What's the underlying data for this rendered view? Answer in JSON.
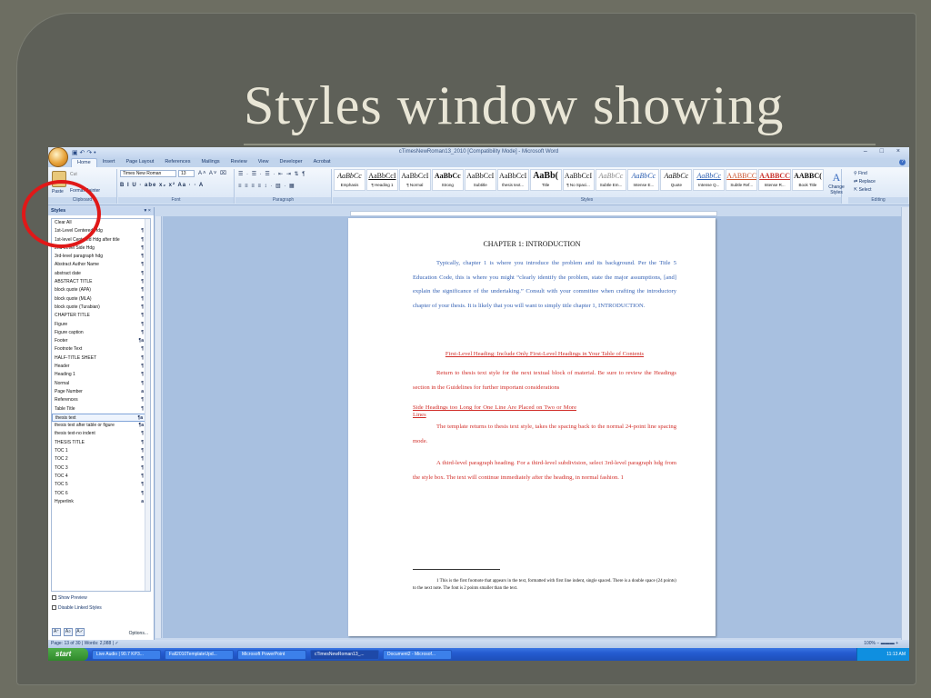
{
  "slide": {
    "title": "Styles window showing"
  },
  "window": {
    "title": "cTimesNewRoman13_2010 [Compatibility Mode] - Microsoft Word",
    "qat": "▣ ↶ ↷ •",
    "controls": "– □ ×"
  },
  "tabs": [
    "Home",
    "Insert",
    "Page Layout",
    "References",
    "Mailings",
    "Review",
    "View",
    "Developer",
    "Acrobat"
  ],
  "ribbon": {
    "clipboard": {
      "label": "Clipboard",
      "paste": "Paste",
      "cut": "Cut",
      "format_painter": "Format Painter"
    },
    "font": {
      "label": "Font",
      "name": "Times New Roman",
      "size": "13",
      "row1": "A˄ A˅ ⌧",
      "row2": "B I U · abe x₂ x² Aa · · A"
    },
    "paragraph": {
      "label": "Paragraph",
      "row1": "☰ · ☰ · ☰ · ⇤ ⇥ ⇅ ¶",
      "row2": "≡ ≡ ≡ ≡ ↕ · ▧ · ▦"
    },
    "styles_label": "Styles",
    "gallery": [
      {
        "sample": "AaBbCc",
        "name": "Emphasis"
      },
      {
        "sample": "AaBbCcI",
        "name": "¶ Heading 1"
      },
      {
        "sample": "AaBbCcI",
        "name": "¶ Normal"
      },
      {
        "sample": "AaBbCc",
        "name": "Strong"
      },
      {
        "sample": "AaBbCcI",
        "name": "Subtitle"
      },
      {
        "sample": "AaBbCcI",
        "name": "thesis text..."
      },
      {
        "sample": "AaBb(",
        "name": "Title"
      },
      {
        "sample": "AaBbCcI",
        "name": "¶ No Spaci..."
      },
      {
        "sample": "AaBbCc",
        "name": "Subtle Em..."
      },
      {
        "sample": "AaBbCc",
        "name": "Intense E..."
      },
      {
        "sample": "AaBbCc",
        "name": "Quote"
      },
      {
        "sample": "AaBbCc",
        "name": "Intense Q..."
      },
      {
        "sample": "AABBCC",
        "name": "Subtle Ref..."
      },
      {
        "sample": "AABBCC",
        "name": "Intense R..."
      },
      {
        "sample": "AABBC(",
        "name": "Book Title"
      }
    ],
    "change_styles": "Change Styles",
    "editing": {
      "label": "Editing",
      "find": "Find",
      "replace": "Replace",
      "select": "Select"
    }
  },
  "styles_pane": {
    "title": "Styles",
    "close": "▾ ×",
    "items": [
      {
        "name": "Clear All",
        "mark": ""
      },
      {
        "name": "1st-Level Centered Hdg",
        "mark": "¶"
      },
      {
        "name": "1st-level Centered Hdg after title",
        "mark": "¶"
      },
      {
        "name": "2nd-Level Side Hdg",
        "mark": "¶"
      },
      {
        "name": "3rd-level paragraph hdg",
        "mark": "¶"
      },
      {
        "name": "Abstract Author Name",
        "mark": "¶"
      },
      {
        "name": "abstract date",
        "mark": "¶"
      },
      {
        "name": "ABSTRACT TITLE",
        "mark": "¶"
      },
      {
        "name": "block quote (APA)",
        "mark": "¶"
      },
      {
        "name": "block quote (MLA)",
        "mark": "¶"
      },
      {
        "name": "block quote (Turabian)",
        "mark": "¶"
      },
      {
        "name": "CHAPTER TITLE",
        "mark": "¶"
      },
      {
        "name": "Figure",
        "mark": "¶"
      },
      {
        "name": "Figure caption",
        "mark": "¶"
      },
      {
        "name": "Footer",
        "mark": "¶a"
      },
      {
        "name": "Footnote Text",
        "mark": "¶"
      },
      {
        "name": "HALF-TITLE SHEET",
        "mark": "¶"
      },
      {
        "name": "Header",
        "mark": "¶"
      },
      {
        "name": "Heading 1",
        "mark": "¶"
      },
      {
        "name": "Normal",
        "mark": "¶"
      },
      {
        "name": "Page Number",
        "mark": "a"
      },
      {
        "name": "References",
        "mark": "¶"
      },
      {
        "name": "Table Title",
        "mark": "¶"
      },
      {
        "name": "thesis text",
        "mark": "¶a"
      },
      {
        "name": "thesis text after table or figure",
        "mark": "¶a"
      },
      {
        "name": "thesis text-no indent",
        "mark": "¶"
      },
      {
        "name": "THESIS TITLE",
        "mark": "¶"
      },
      {
        "name": "TOC 1",
        "mark": "¶"
      },
      {
        "name": "TOC 2",
        "mark": "¶"
      },
      {
        "name": "TOC 3",
        "mark": "¶"
      },
      {
        "name": "TOC 4",
        "mark": "¶"
      },
      {
        "name": "TOC 5",
        "mark": "¶"
      },
      {
        "name": "TOC 6",
        "mark": "¶"
      },
      {
        "name": "Hyperlink",
        "mark": "a"
      }
    ],
    "selected": "thesis text",
    "show_preview": "Show Preview",
    "disable_linked": "Disable Linked Styles",
    "options": "Options..."
  },
  "document": {
    "heading": "CHAPTER 1: INTRODUCTION",
    "para1": "Typically, chapter 1 is where you introduce the problem and its background.  Per the Title 5 Education Code, this is where you might “clearly identify the problem, state the major assumptions, [and] explain the significance of the undertaking.”  Consult with your committee when crafting the introductory chapter of your thesis.  It is likely that you will want to simply title chapter 1, INTRODUCTION.",
    "first_level_heading": "First-Level Heading: Include Only First-Level Headings in Your Table of Contents",
    "para2": "Return to thesis text style for the next textual block of material. Be sure to review the Headings section in the Guidelines for further important considerations",
    "side_heading": "Side Headings too Long for One Line Are Placed on Two or More Lines",
    "para3": "The template returns to thesis text style, takes the spacing back to the normal 24-point line spacing mode.",
    "para4": "A third-level paragraph heading. For a third-level subdivision, select 3rd-level paragraph hdg from the style box. The text will continue immediately after the heading, in normal fashion. 1",
    "footnote": "1 This is the first footnote that appears in the text, formatted with first line indent, single spaced. There is a double space (24 points) to the next note. The font is 2 points smaller than the text."
  },
  "status": {
    "left": "Page: 13 of 30 | Words: 2,088 | ✓",
    "right": "100% − ▬▬▬ + "
  },
  "taskbar": {
    "start": "start",
    "tasks": [
      "Live Audio | 90.7 KP3...",
      "Fall2010TemplateUpd...",
      "Microsoft PowerPoint",
      "cTimesNewRoman13_...",
      "Document2 - Microsof..."
    ],
    "clock": "11:13 AM"
  },
  "colors": {
    "annotation": "#e01818",
    "slide_bg": "#5e6058",
    "title_text": "#e9e6d6",
    "taskbar": "#245bd0"
  }
}
